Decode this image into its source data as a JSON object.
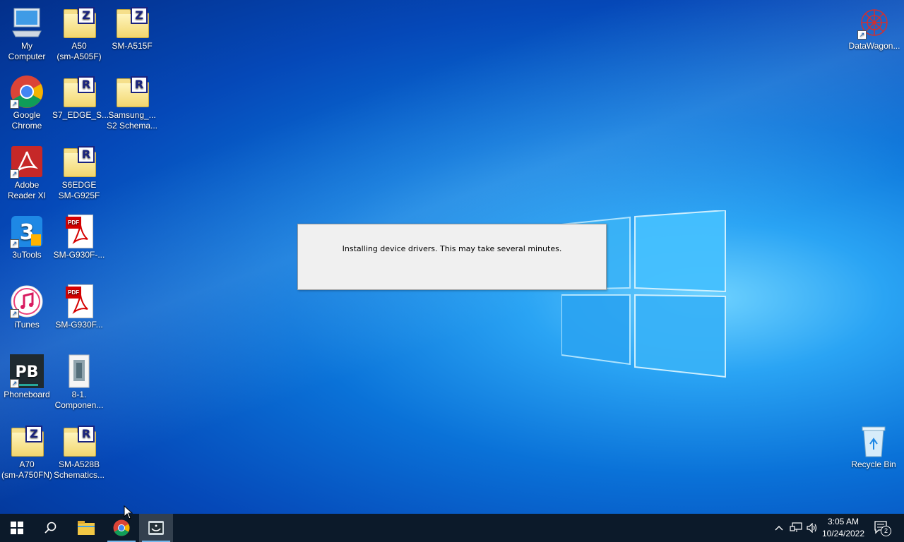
{
  "desktop": {
    "icons": [
      {
        "name": "my-computer-icon",
        "label": "My\nComputer"
      },
      {
        "name": "folder-a50-icon",
        "label": "A50\n(sm-A505F)",
        "badge": "Z"
      },
      {
        "name": "folder-sm-a515f-icon",
        "label": "SM-A515F",
        "badge": "Z"
      },
      {
        "name": "google-chrome-icon",
        "label": "Google\nChrome"
      },
      {
        "name": "folder-s7-edge-icon",
        "label": "S7_EDGE_S...",
        "badge": "R"
      },
      {
        "name": "folder-samsung-s2-icon",
        "label": "Samsung_...\nS2 Schema...",
        "badge": "R"
      },
      {
        "name": "adobe-reader-icon",
        "label": "Adobe\nReader XI"
      },
      {
        "name": "folder-s6edge-icon",
        "label": "S6EDGE\nSM-G925F",
        "badge": "R"
      },
      {
        "name": "3utools-icon",
        "label": "3uTools"
      },
      {
        "name": "pdf-sm-g930f-1-icon",
        "label": "SM-G930F-...",
        "pdf_tag": "PDF"
      },
      {
        "name": "itunes-icon",
        "label": "iTunes"
      },
      {
        "name": "pdf-sm-g930f-2-icon",
        "label": "SM-G930F...",
        "pdf_tag": "PDF"
      },
      {
        "name": "phoneboard-icon",
        "label": "Phoneboard",
        "logo": "PB"
      },
      {
        "name": "component-file-icon",
        "label": "8-1.\nComponen..."
      },
      {
        "name": "folder-a70-icon",
        "label": "A70\n(sm-A750FN)",
        "badge": "Z"
      },
      {
        "name": "folder-sm-a528b-icon",
        "label": "SM-A528B\nSchematics...",
        "badge": "R"
      },
      {
        "name": "datawagon-icon",
        "label": "DataWagon..."
      },
      {
        "name": "recycle-bin-icon",
        "label": "Recycle Bin"
      }
    ]
  },
  "dialog": {
    "message": "Installing device drivers. This may take several minutes."
  },
  "taskbar": {
    "pinned": [
      "start-button",
      "search-button",
      "file-explorer-button",
      "chrome-taskbar-button",
      "installer-taskbar-button"
    ],
    "clock": {
      "time": "3:05 AM",
      "date": "10/24/2022"
    },
    "notification_count": "2"
  },
  "colors": {
    "taskbar": "#0c1a2a",
    "desktop_accent": "#0a72d8",
    "dialog_bg": "#f0f0f0"
  }
}
